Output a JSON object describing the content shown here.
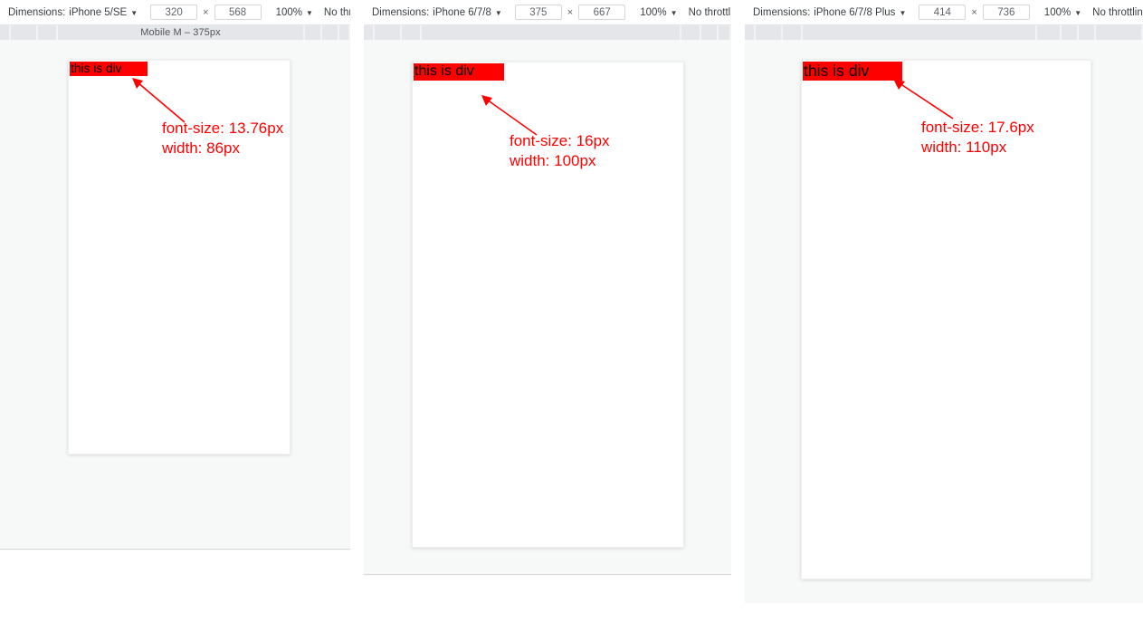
{
  "meta": {
    "accent_red": "#ff0000",
    "toolbar_text_color": "#3c4043",
    "panel_bg": "#f7f8f8",
    "mq_bar_bg": "#f2f3f4",
    "mq_segment_color": "#e4e6e9"
  },
  "panels": [
    {
      "id": "panel-iphone-5-se",
      "toolbar": {
        "dimensions_label": "Dimensions:",
        "device_name": "iPhone 5/SE",
        "device_caret": "▼",
        "width_value": "320",
        "width_placeholder": "320",
        "times_symbol": "×",
        "height_value": "568",
        "height_placeholder": "568",
        "zoom_value": "100%",
        "zoom_caret": "▼",
        "throttling_value": "No throttling",
        "throttling_caret": "▼"
      },
      "media_query_bar": {
        "label": "Mobile M – 375px",
        "has_label": true
      },
      "viewport": {
        "div_text": "this is div"
      },
      "annotation": {
        "font_size_line": "font-size: 13.76px",
        "width_line": "width: 86px"
      }
    },
    {
      "id": "panel-iphone-6-7-8",
      "toolbar": {
        "dimensions_label": "Dimensions:",
        "device_name": "iPhone 6/7/8",
        "device_caret": "▼",
        "width_value": "375",
        "width_placeholder": "375",
        "times_symbol": "×",
        "height_value": "667",
        "height_placeholder": "667",
        "zoom_value": "100%",
        "zoom_caret": "▼",
        "throttling_value": "No throttling",
        "throttling_caret": "▼"
      },
      "media_query_bar": {
        "label": "",
        "has_label": false
      },
      "viewport": {
        "div_text": "this is div"
      },
      "annotation": {
        "font_size_line": "font-size: 16px",
        "width_line": "width: 100px"
      }
    },
    {
      "id": "panel-iphone-6-7-8-plus",
      "toolbar": {
        "dimensions_label": "Dimensions:",
        "device_name": "iPhone 6/7/8 Plus",
        "device_caret": "▼",
        "width_value": "414",
        "width_placeholder": "414",
        "times_symbol": "×",
        "height_value": "736",
        "height_placeholder": "736",
        "zoom_value": "100%",
        "zoom_caret": "▼",
        "throttling_value": "No throttling",
        "throttling_caret": "▼"
      },
      "media_query_bar": {
        "label": "",
        "has_label": false
      },
      "viewport": {
        "div_text": "this is div"
      },
      "annotation": {
        "font_size_line": "font-size: 17.6px",
        "width_line": "width: 110px"
      }
    }
  ]
}
